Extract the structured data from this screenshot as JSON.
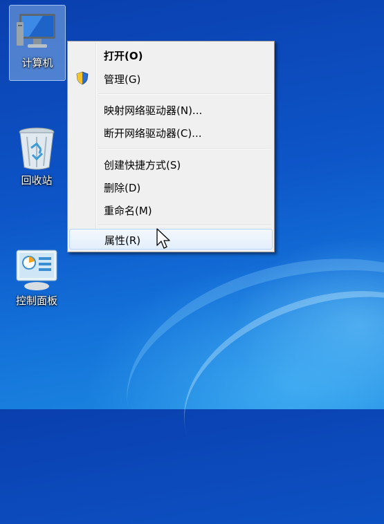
{
  "desktop": {
    "icons": [
      {
        "label": "计算机"
      },
      {
        "label": "回收站"
      },
      {
        "label": "控制面板"
      }
    ]
  },
  "context_menu": {
    "items": [
      {
        "label": "打开(O)",
        "bold": true
      },
      {
        "label": "管理(G)",
        "icon": "uac-shield-icon"
      },
      {
        "label": "映射网络驱动器(N)..."
      },
      {
        "label": "断开网络驱动器(C)..."
      },
      {
        "label": "创建快捷方式(S)"
      },
      {
        "label": "删除(D)"
      },
      {
        "label": "重命名(M)"
      },
      {
        "label": "属性(R)",
        "hovered": true
      }
    ]
  },
  "colors": {
    "menu_bg": "#f0f0f0",
    "hover_border": "#b8d6fb",
    "desktop_blue": "#0d55c8"
  }
}
